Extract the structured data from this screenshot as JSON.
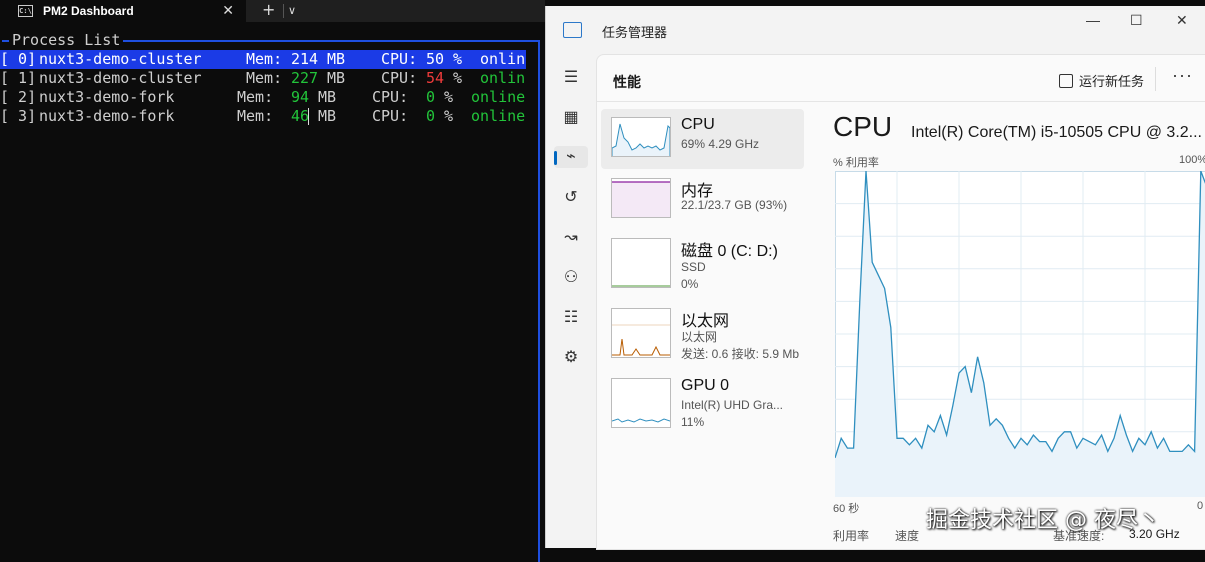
{
  "terminal": {
    "tab_title": "PM2 Dashboard",
    "tab_icon": "C:\\",
    "tab_close": "✕",
    "new_tab": "+",
    "tab_dropdown": "∨",
    "panel_title": "Process List",
    "processes": [
      {
        "idx": "[ 0]",
        "name": "nuxt3-demo-cluster",
        "mem_label": "Mem:",
        "mem_value": "214",
        "mem_unit": "MB",
        "cpu_label": "CPU:",
        "cpu_value": "50",
        "cpu_unit": "%",
        "status": "onlin"
      },
      {
        "idx": "[ 1]",
        "name": "nuxt3-demo-cluster",
        "mem_label": "Mem:",
        "mem_value": "227",
        "mem_unit": "MB",
        "cpu_label": "CPU:",
        "cpu_value": "54",
        "cpu_unit": "%",
        "status": "onlin"
      },
      {
        "idx": "[ 2]",
        "name": "nuxt3-demo-fork",
        "mem_label": "Mem:",
        "mem_value": "94",
        "mem_unit": "MB",
        "cpu_label": "CPU:",
        "cpu_value": "0",
        "cpu_unit": "%",
        "status": "online"
      },
      {
        "idx": "[ 3]",
        "name": "nuxt3-demo-fork",
        "mem_label": "Mem:",
        "mem_value": "46",
        "mem_unit": "MB",
        "cpu_label": "CPU:",
        "cpu_value": "0",
        "cpu_unit": "%",
        "status": "online"
      }
    ]
  },
  "taskmgr": {
    "title": "任务管理器",
    "window_controls": {
      "minimize": "—",
      "maximize": "☐",
      "close": "✕"
    },
    "nav_icons": [
      "hamburger-icon",
      "processes-icon",
      "performance-icon",
      "app-history-icon",
      "startup-icon",
      "users-icon",
      "details-icon",
      "services-icon"
    ],
    "nav_glyphs": [
      "☰",
      "▦",
      "⌁",
      "↺",
      "↝",
      "⚇",
      "☷",
      "⚙"
    ],
    "page_title": "性能",
    "run_task": "运行新任务",
    "more": "···",
    "devices": [
      {
        "name": "CPU",
        "line1": "69% 4.29 GHz",
        "line2": ""
      },
      {
        "name": "内存",
        "line1": "22.1/23.7 GB (93%)",
        "line2": ""
      },
      {
        "name": "磁盘 0 (C: D:)",
        "line1": "SSD",
        "line2": "0%"
      },
      {
        "name": "以太网",
        "line1": "以太网",
        "line2": "发送: 0.6 接收: 5.9 Mb"
      },
      {
        "name": "GPU 0",
        "line1": "Intel(R) UHD Gra...",
        "line2": "11%"
      }
    ],
    "cpu_heading": "CPU",
    "cpu_model": "Intel(R) Core(TM) i5-10505 CPU @ 3.2...",
    "y_label": "% 利用率",
    "y_max_label": "100%",
    "x_left_label": "60 秒",
    "x_right_label": "0",
    "stats": {
      "util_label": "利用率",
      "speed_label": "速度",
      "base_speed_label": "基准速度:",
      "base_speed_value": "3.20 GHz"
    },
    "colors": {
      "cpu_line": "#2f8fbf",
      "cpu_fill": "#eaf3fa",
      "mem_line": "#8a1f9e",
      "net_line": "#b85c00"
    }
  },
  "watermark": "掘金技术社区 @ 夜尽丶",
  "chart_data": {
    "type": "area",
    "title": "CPU",
    "ylabel": "% 利用率",
    "ylim": [
      0,
      100
    ],
    "x": [
      60,
      59,
      58,
      57,
      56,
      55,
      54,
      53,
      52,
      51,
      50,
      49,
      48,
      47,
      46,
      45,
      44,
      43,
      42,
      41,
      40,
      39,
      38,
      37,
      36,
      35,
      34,
      33,
      32,
      31,
      30,
      29,
      28,
      27,
      26,
      25,
      24,
      23,
      22,
      21,
      20,
      19,
      18,
      17,
      16,
      15,
      14,
      13,
      12,
      11,
      10,
      9,
      8,
      7,
      6,
      5,
      4,
      3,
      2,
      1,
      0
    ],
    "series": [
      {
        "name": "",
        "values": [
          12,
          18,
          15,
          15,
          60,
          100,
          72,
          68,
          64,
          52,
          18,
          18,
          16,
          18,
          15,
          22,
          20,
          25,
          19,
          28,
          38,
          40,
          32,
          43,
          35,
          22,
          24,
          22,
          18,
          15,
          18,
          16,
          19,
          17,
          17,
          14,
          18,
          20,
          20,
          15,
          18,
          17,
          16,
          19,
          14,
          18,
          25,
          19,
          14,
          18,
          16,
          20,
          15,
          18,
          14,
          14,
          14,
          16,
          14,
          100,
          95
        ]
      }
    ]
  }
}
